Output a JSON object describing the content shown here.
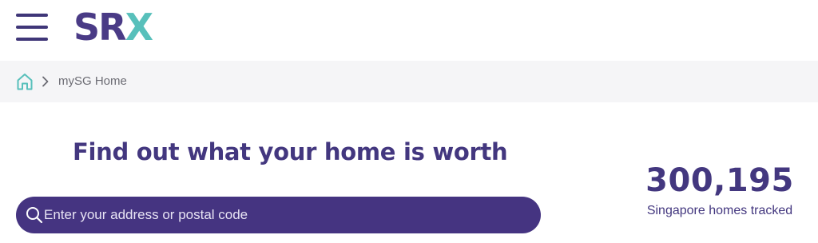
{
  "header": {
    "menu_icon": "hamburger-menu-icon",
    "logo": {
      "part1": "SR",
      "part2": "X",
      "primary_color": "#4a3b86",
      "accent_color": "#58c0bb"
    }
  },
  "breadcrumb": {
    "home_icon": "home-icon",
    "separator_icon": "chevron-right-icon",
    "current": "mySG Home"
  },
  "main": {
    "headline": "Find out what your home is worth",
    "search": {
      "placeholder": "Enter your address or postal code",
      "value": "",
      "icon": "search-icon"
    },
    "stats": {
      "count": "300,195",
      "label": "Singapore homes tracked"
    }
  },
  "colors": {
    "brand_purple": "#453481",
    "brand_teal": "#58c0bb",
    "breadcrumb_bg": "#f5f5f7"
  }
}
